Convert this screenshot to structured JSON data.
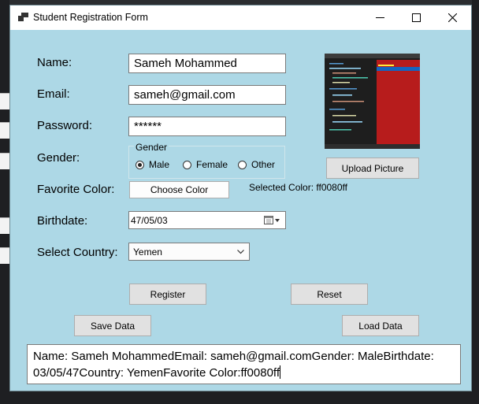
{
  "window": {
    "title": "Student Registration Form"
  },
  "form": {
    "name_label": "Name:",
    "name_value": "Sameh Mohammed",
    "email_label": "Email:",
    "email_value": "sameh@gmail.com",
    "password_label": "Password:",
    "password_value": "******",
    "gender_label": "Gender:",
    "gender_group_title": "Gender",
    "gender_options": [
      "Male",
      "Female",
      "Other"
    ],
    "gender_selected": "Male",
    "color_label": "Favorite Color:",
    "choose_color_button": "Choose Color",
    "selected_color_text": "Selected Color: ff0080ff",
    "birthdate_label": "Birthdate:",
    "birthdate_value": "47/05/03",
    "country_label": "Select Country:",
    "country_value": "Yemen",
    "upload_button": "Upload Picture",
    "register_button": "Register",
    "reset_button": "Reset",
    "save_button": "Save Data",
    "load_button": "Load Data",
    "output_text": "Name: Sameh MohammedEmail: sameh@gmail.comGender: MaleBirthdate: 03/05/47Country: YemenFavorite Color:ff0080ff"
  },
  "colors": {
    "form_background": "#add8e6",
    "picture_panel": "#b71c1c"
  },
  "icons": {
    "calendar": "calendar-icon",
    "dropdown": "chevron-down-icon"
  }
}
